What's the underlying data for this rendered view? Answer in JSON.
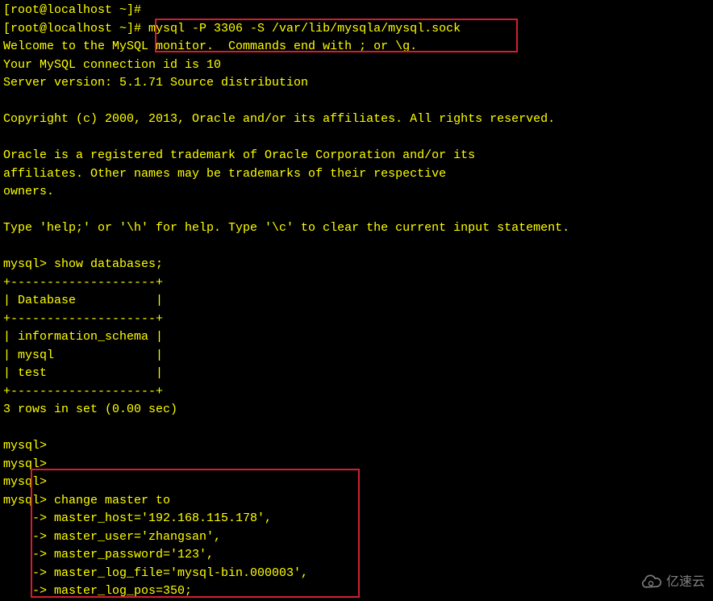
{
  "terminal": {
    "lines": [
      "[root@localhost ~]#",
      "[root@localhost ~]# mysql -P 3306 -S /var/lib/mysqla/mysql.sock",
      "Welcome to the MySQL monitor.  Commands end with ; or \\g.",
      "Your MySQL connection id is 10",
      "Server version: 5.1.71 Source distribution",
      "",
      "Copyright (c) 2000, 2013, Oracle and/or its affiliates. All rights reserved.",
      "",
      "Oracle is a registered trademark of Oracle Corporation and/or its",
      "affiliates. Other names may be trademarks of their respective",
      "owners.",
      "",
      "Type 'help;' or '\\h' for help. Type '\\c' to clear the current input statement.",
      "",
      "mysql> show databases;",
      "+--------------------+",
      "| Database           |",
      "+--------------------+",
      "| information_schema |",
      "| mysql              |",
      "| test               |",
      "+--------------------+",
      "3 rows in set (0.00 sec)",
      "",
      "mysql>",
      "mysql>",
      "mysql>",
      "mysql> change master to",
      "    -> master_host='192.168.115.178',",
      "    -> master_user='zhangsan',",
      "    -> master_password='123',",
      "    -> master_log_file='mysql-bin.000003',",
      "    -> master_log_pos=350;"
    ]
  },
  "watermark": {
    "text": "亿速云"
  }
}
